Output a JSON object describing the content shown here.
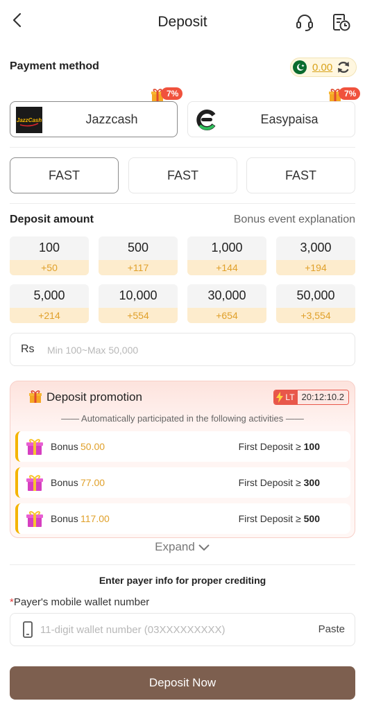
{
  "header": {
    "title": "Deposit",
    "back_icon": "chevron-left-icon",
    "support_icon": "headset-icon",
    "history_icon": "history-icon"
  },
  "payment": {
    "label": "Payment method",
    "balance": "0.00",
    "methods": [
      {
        "name": "Jazzcash",
        "badge": "7%",
        "selected": true,
        "logo_text": "JazzCash"
      },
      {
        "name": "Easypaisa",
        "badge": "7%",
        "selected": false
      }
    ],
    "channels": [
      "FAST",
      "FAST",
      "FAST"
    ]
  },
  "amount": {
    "label": "Deposit amount",
    "bonus_explanation": "Bonus event explanation",
    "options": [
      {
        "value": "100",
        "bonus": "+50"
      },
      {
        "value": "500",
        "bonus": "+117"
      },
      {
        "value": "1,000",
        "bonus": "+144"
      },
      {
        "value": "3,000",
        "bonus": "+194"
      },
      {
        "value": "5,000",
        "bonus": "+214"
      },
      {
        "value": "10,000",
        "bonus": "+554"
      },
      {
        "value": "30,000",
        "bonus": "+654"
      },
      {
        "value": "50,000",
        "bonus": "+3,554"
      }
    ],
    "currency": "Rs",
    "placeholder": "Min 100~Max 50,000"
  },
  "promotion": {
    "title": "Deposit promotion",
    "lt_label": "LT",
    "countdown": "20:12:10.2",
    "subtitle": "—— Automatically participated in the following activities ——",
    "rows": [
      {
        "label": "Bonus",
        "amount": "50.00",
        "condition_text": "First Deposit ≥ ",
        "condition_value": "100"
      },
      {
        "label": "Bonus",
        "amount": "77.00",
        "condition_text": "First Deposit ≥ ",
        "condition_value": "300"
      },
      {
        "label": "Bonus",
        "amount": "117.00",
        "condition_text": "First Deposit ≥ ",
        "condition_value": "500"
      }
    ],
    "expand": "Expand"
  },
  "payer": {
    "note": "Enter payer info for proper crediting",
    "required_mark": "*",
    "wallet_label": "Payer's mobile wallet number",
    "wallet_placeholder": "11-digit wallet number (03XXXXXXXXX)",
    "paste": "Paste"
  },
  "cta": {
    "label": "Deposit Now"
  },
  "colors": {
    "accent_gold": "#e0a02a",
    "button_brown": "#7d5f4f",
    "badge_red": "#f0523d"
  }
}
